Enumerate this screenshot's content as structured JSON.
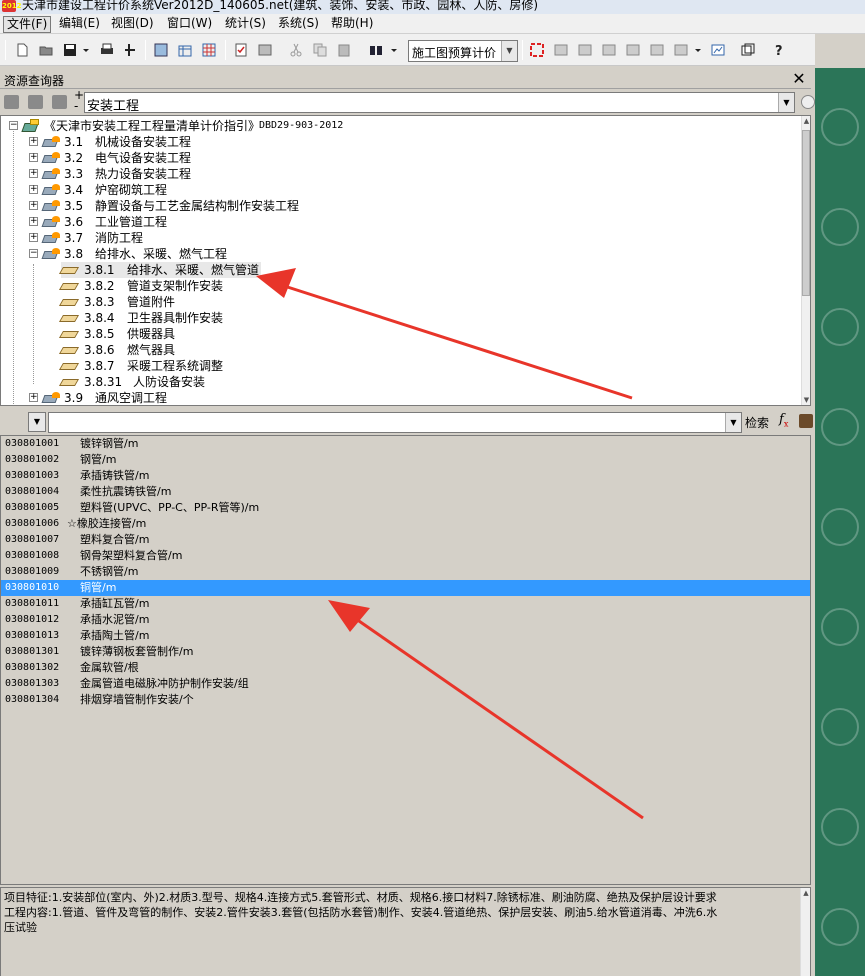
{
  "window": {
    "title": "天津市建设工程计价系统Ver2012D_140605.net(建筑、装饰、安装、市政、园林、人防、房修)",
    "app_icon_text": "2012"
  },
  "menu": {
    "items": [
      {
        "label": "文件(F)"
      },
      {
        "label": "编辑(E)"
      },
      {
        "label": "视图(D)"
      },
      {
        "label": "窗口(W)"
      },
      {
        "label": "统计(S)"
      },
      {
        "label": "系统(S)"
      },
      {
        "label": "帮助(H)"
      }
    ]
  },
  "toolbar": {
    "mode_select_value": "施工图预算计价",
    "icons": [
      "new-document",
      "open-folder",
      "save",
      "print",
      "insert-row",
      "calculator",
      "table-edit",
      "table-grid",
      "check-list",
      "report",
      "cut",
      "copy",
      "paste",
      "binoculars",
      "select-frame",
      "window-1",
      "window-2",
      "window-3",
      "window-4",
      "window-5",
      "window-6",
      "chart-settings",
      "help"
    ]
  },
  "resource_panel": {
    "title": "资源查询器",
    "close_glyph": "✕",
    "category_value": "安装工程",
    "plus": "+",
    "minus": "-"
  },
  "tree": {
    "root": {
      "label": "《天津市安装工程工程量清单计价指引》",
      "code": "DBD29-903-2012"
    },
    "chapters": [
      {
        "code": "3.1",
        "name": "机械设备安装工程",
        "expanded": false
      },
      {
        "code": "3.2",
        "name": "电气设备安装工程",
        "expanded": false
      },
      {
        "code": "3.3",
        "name": "热力设备安装工程",
        "expanded": false
      },
      {
        "code": "3.4",
        "name": "炉窑砌筑工程",
        "expanded": false
      },
      {
        "code": "3.5",
        "name": "静置设备与工艺金属结构制作安装工程",
        "expanded": false
      },
      {
        "code": "3.6",
        "name": "工业管道工程",
        "expanded": false
      },
      {
        "code": "3.7",
        "name": "消防工程",
        "expanded": false
      },
      {
        "code": "3.8",
        "name": "给排水、采暖、燃气工程",
        "expanded": true
      },
      {
        "code": "3.9",
        "name": "通风空调工程",
        "expanded": false
      }
    ],
    "sections": [
      {
        "code": "3.8.1",
        "name": "给排水、采暖、燃气管道"
      },
      {
        "code": "3.8.2",
        "name": "管道支架制作安装"
      },
      {
        "code": "3.8.3",
        "name": "管道附件"
      },
      {
        "code": "3.8.4",
        "name": "卫生器具制作安装"
      },
      {
        "code": "3.8.5",
        "name": "供暖器具"
      },
      {
        "code": "3.8.6",
        "name": "燃气器具"
      },
      {
        "code": "3.8.7",
        "name": "采暖工程系统调整"
      },
      {
        "code": "3.8.31",
        "name": "人防设备安装"
      }
    ]
  },
  "filter": {
    "search_label": "检索",
    "fx_label": "f",
    "fx_sub": "x"
  },
  "items": [
    {
      "code": "030801001",
      "name": "镀锌钢管/m"
    },
    {
      "code": "030801002",
      "name": "钢管/m"
    },
    {
      "code": "030801003",
      "name": "承插铸铁管/m"
    },
    {
      "code": "030801004",
      "name": "柔性抗震铸铁管/m"
    },
    {
      "code": "030801005",
      "name": "塑料管(UPVC、PP-C、PP-R管等)/m"
    },
    {
      "code": "030801006",
      "name": "☆橡胶连接管/m",
      "star": true
    },
    {
      "code": "030801007",
      "name": "塑料复合管/m"
    },
    {
      "code": "030801008",
      "name": "钢骨架塑料复合管/m"
    },
    {
      "code": "030801009",
      "name": "不锈钢管/m"
    },
    {
      "code": "030801010",
      "name": "铜管/m",
      "selected": true
    },
    {
      "code": "030801011",
      "name": "承插缸瓦管/m"
    },
    {
      "code": "030801012",
      "name": "承插水泥管/m"
    },
    {
      "code": "030801013",
      "name": "承插陶土管/m"
    },
    {
      "code": "030801301",
      "name": "镀锌薄钢板套管制作/m"
    },
    {
      "code": "030801302",
      "name": "金属软管/根"
    },
    {
      "code": "030801303",
      "name": "金属管道电磁脉冲防护制作安装/组"
    },
    {
      "code": "030801304",
      "name": "排烟穿墙管制作安装/个"
    }
  ],
  "description": {
    "line1": "项目特征:1.安装部位(室内、外)2.材质3.型号、规格4.连接方式5.套管形式、材质、规格6.接口材料7.除锈标准、刷油防腐、绝热及保护层设计要求",
    "line2": "工程内容:1.管道、管件及弯管的制作、安装2.管件安装3.套管(包括防水套管)制作、安装4.管道绝热、保护层安装、刷油5.给水管道消毒、冲洗6.水",
    "line3": "压试验"
  },
  "colors": {
    "selection": "#3399ff",
    "annotation_arrow": "#e8352a",
    "side_background": "#2b7558"
  }
}
